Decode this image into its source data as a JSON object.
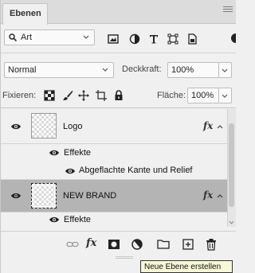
{
  "panel": {
    "tab_label": "Ebenen"
  },
  "filter": {
    "kind_label": "Art",
    "icons": [
      "image-filter-icon",
      "adjustment-filter-icon",
      "type-filter-icon",
      "shape-filter-icon",
      "smart-object-filter-icon"
    ]
  },
  "blend": {
    "mode": "Normal",
    "opacity_label": "Deckkraft:",
    "opacity_value": "100%"
  },
  "lock": {
    "label": "Fixieren:",
    "fill_label": "Fläche:",
    "fill_value": "100%"
  },
  "layers": [
    {
      "name": "Logo",
      "fx": "fx",
      "effects_label": "Effekte",
      "effects": [
        "Abgeflachte Kante und Relief"
      ]
    },
    {
      "name": "NEW BRAND",
      "fx": "fx",
      "effects_label": "Effekte",
      "effects": []
    }
  ],
  "toolbar": {
    "fx_label": "fx"
  },
  "tooltip": {
    "text": "Neue Ebene erstellen"
  }
}
